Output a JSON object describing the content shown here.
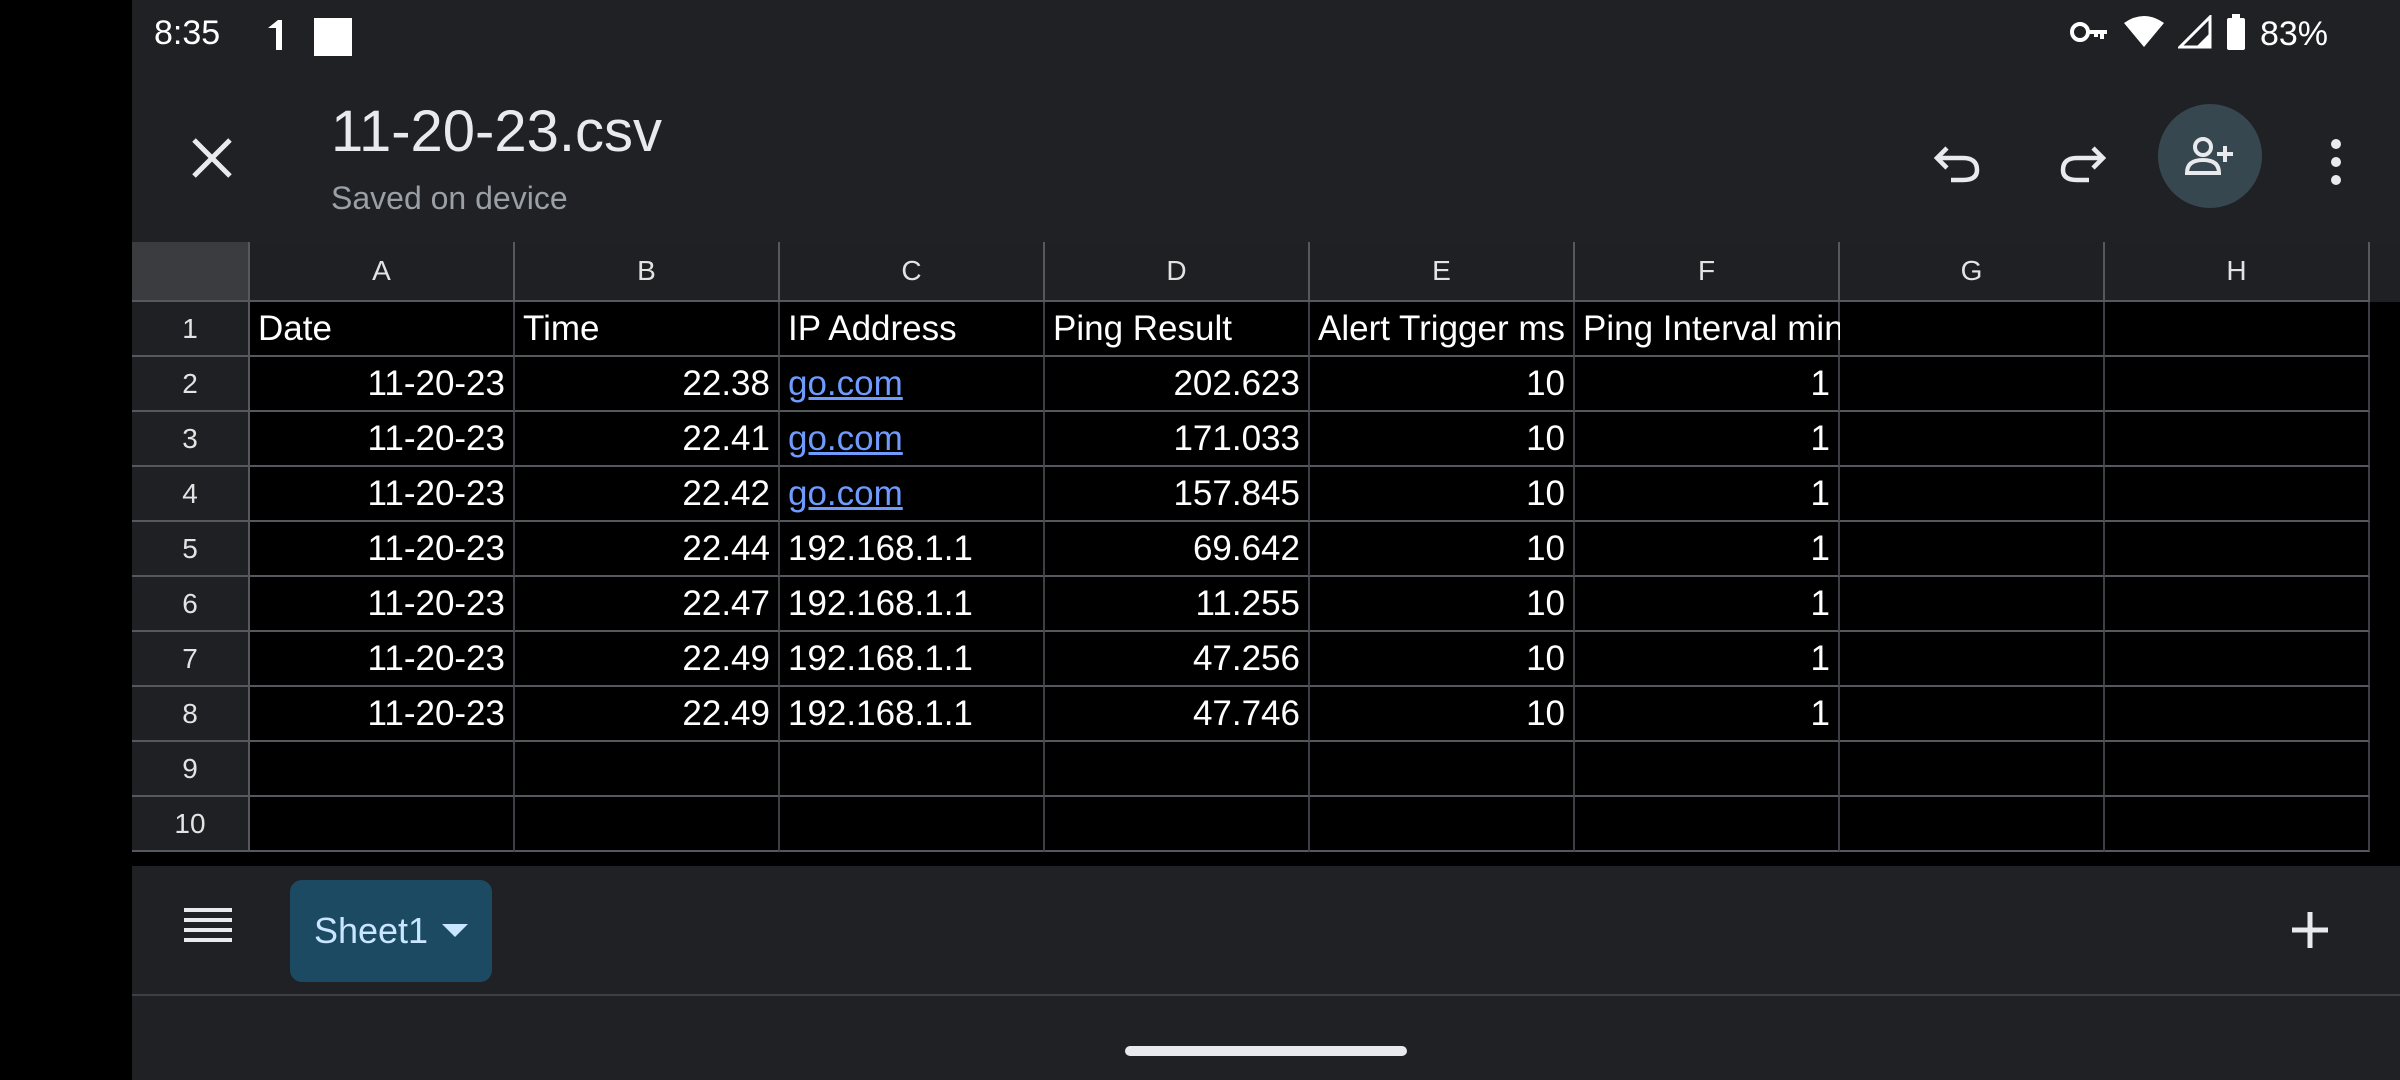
{
  "status_bar": {
    "time": "8:35",
    "icons": [
      "notification-icon",
      "square-notification-icon",
      "vpn-key-icon",
      "wifi-icon",
      "signal-icon",
      "battery-icon"
    ],
    "battery": "83%"
  },
  "app_bar": {
    "title": "11-20-23.csv",
    "subtitle": "Saved on device",
    "icons": [
      "close-icon",
      "undo-icon",
      "redo-icon",
      "add-person-icon",
      "more-vert-icon"
    ],
    "accent": "#37474f"
  },
  "grid": {
    "columns": [
      "A",
      "B",
      "C",
      "D",
      "E",
      "F",
      "G",
      "H"
    ],
    "row_numbers": [
      "1",
      "2",
      "3",
      "4",
      "5",
      "6",
      "7",
      "8",
      "9",
      "10"
    ],
    "header_row": [
      "Date",
      "Time",
      "IP Address",
      "Ping Result",
      "Alert Trigger ms",
      "Ping Interval minutes",
      "",
      ""
    ],
    "rows": [
      [
        "11-20-23",
        "22.38",
        "go.com",
        "202.623",
        "10",
        "1",
        "",
        ""
      ],
      [
        "11-20-23",
        "22.41",
        "go.com",
        "171.033",
        "10",
        "1",
        "",
        ""
      ],
      [
        "11-20-23",
        "22.42",
        "go.com",
        "157.845",
        "10",
        "1",
        "",
        ""
      ],
      [
        "11-20-23",
        "22.44",
        "192.168.1.1",
        "69.642",
        "10",
        "1",
        "",
        ""
      ],
      [
        "11-20-23",
        "22.47",
        "192.168.1.1",
        "11.255",
        "10",
        "1",
        "",
        ""
      ],
      [
        "11-20-23",
        "22.49",
        "192.168.1.1",
        "47.256",
        "10",
        "1",
        "",
        ""
      ],
      [
        "11-20-23",
        "22.49",
        "192.168.1.1",
        "47.746",
        "10",
        "1",
        "",
        ""
      ],
      [
        "",
        "",
        "",
        "",
        "",
        "",
        "",
        ""
      ],
      [
        "",
        "",
        "",
        "",
        "",
        "",
        "",
        ""
      ]
    ],
    "link_color": "#6f9bff"
  },
  "sheet_bar": {
    "active_sheet": "Sheet1",
    "tab_color": "#1c4a63",
    "icons": [
      "sheets-list-icon",
      "dropdown-arrow-icon",
      "add-sheet-icon"
    ]
  }
}
